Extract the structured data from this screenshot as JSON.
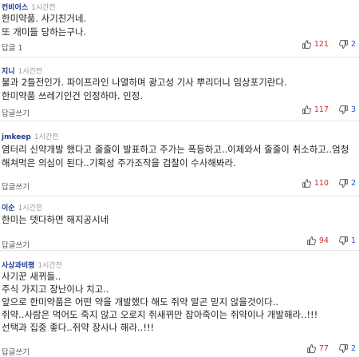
{
  "comments": [
    {
      "user": "컨비어스",
      "time": "1시간전",
      "lines": [
        "한미약품. 사기친거네.",
        "또 개미들 당하는구나."
      ],
      "reply_label": "답글 1",
      "likes": "121",
      "dislikes": "2"
    },
    {
      "user": "지니",
      "time": "1시간전",
      "lines": [
        "불과 2틀전인가. 파이프라인 나열하며 광고성 기사 뿌리더니 임상포기란다.",
        "한미약품 쓰레기인건 인정하마. 인정."
      ],
      "reply_label": "답글쓰기",
      "likes": "117",
      "dislikes": "3"
    },
    {
      "user": "jmkeep",
      "time": "1시간전",
      "lines": [
        "염터리 신약개발 했다고 줄줄이 발표하고 주가는 폭등하고..이제와서 줄줄이 취소하고..엄청",
        "해쳐먹은 의심이 된다..기획성 주가조작을 검찰이 수사해봐라."
      ],
      "reply_label": "답글쓰기",
      "likes": "110",
      "dislikes": "2"
    },
    {
      "user": "이순",
      "time": "1시간전",
      "lines": [
        "한미는  뎃다하면  해지공시네"
      ],
      "reply_label": "답글쓰기",
      "likes": "94",
      "dislikes": "1"
    },
    {
      "user": "사상과비평",
      "time": "1시간전",
      "lines": [
        "사기꾼 새뀌들..",
        "주식 가지고 장난이나 치고..",
        "앞으로 한미약품은 어떤 약을 개발했다 해도 쥐약 말곤 믿지 않을것이다..",
        "쥐약..사람은 먹어도 죽지 않고 오로지 쥐새뀌만 잡아죽이는 쥐약이나 개발해라..!!!",
        "선택과 집중 좋다..쥐약 장사나 해라..!!!"
      ],
      "reply_label": "답글쓰기",
      "likes": "77",
      "dislikes": "2"
    }
  ],
  "icons": {
    "like": "thumbs-up-icon",
    "dislike": "thumbs-down-icon"
  },
  "colors": {
    "username": "#1e3d8f",
    "like": "#d12d2d",
    "dislike": "#2a5bd7"
  }
}
